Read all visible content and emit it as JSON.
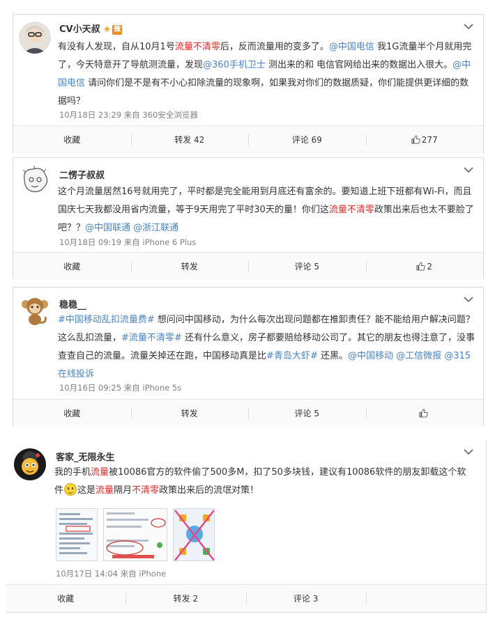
{
  "posts": [
    {
      "user": "CV小天叔",
      "badge_star": "★",
      "badge_vip": "微",
      "text_segments": [
        {
          "t": "有没有人发现，自从10月1号",
          "k": "n"
        },
        {
          "t": "流量不清零",
          "k": "h"
        },
        {
          "t": "后，反而流量用的变多了。",
          "k": "n"
        },
        {
          "t": "@中国电信",
          "k": "l"
        },
        {
          "t": " 我1G流量半个月就用完了，今天特意开了导航测流量，发现",
          "k": "n"
        },
        {
          "t": "@360手机卫士",
          "k": "l"
        },
        {
          "t": " 测出来的和 电信官网给出来的数据出入很大。",
          "k": "n"
        },
        {
          "t": "@中国电信",
          "k": "l"
        },
        {
          "t": " 请问你们是不是有不小心扣除流量的现象啊，如果我对你们的数据质疑，你们能提供更详细的数据吗？",
          "k": "n"
        }
      ],
      "meta": "10月18日 23:29 来自 360安全浏览器",
      "actions": {
        "collect": "收藏",
        "repost": "转发 42",
        "comment": "评论 69",
        "like": "277"
      }
    },
    {
      "user": "二愣子叔叔",
      "text_segments": [
        {
          "t": "这个月流量居然16号就用完了，平时都是完全能用到月底还有富余的。要知道上班下班都有Wi-Fi，而且国庆七天我都没用省内流量，等于9天用完了平时30天的量！你们这",
          "k": "n"
        },
        {
          "t": "流量不清零",
          "k": "h"
        },
        {
          "t": "政策出来后也太不要脸了吧？？",
          "k": "n"
        },
        {
          "t": "@中国联通",
          "k": "l"
        },
        {
          "t": " ",
          "k": "n"
        },
        {
          "t": "@浙江联通",
          "k": "l"
        }
      ],
      "meta": "10月18日 09:19 来自 iPhone 6 Plus",
      "actions": {
        "collect": "收藏",
        "repost": "转发",
        "comment": "评论 5",
        "like": "2"
      }
    },
    {
      "user": "稳稳__",
      "text_segments": [
        {
          "t": "#中国移动乱扣流量费#",
          "k": "l"
        },
        {
          "t": " 想问问中国移动，为什么每次出现问题都在推卸责任？能不能给用户解决问题？这么乱扣流量，",
          "k": "n"
        },
        {
          "t": "#流量不清零#",
          "k": "l"
        },
        {
          "t": " 还有什么意义，房子都要赔给移动公司了。其它的朋友也得注意了，没事查查自己的流量。流量关掉还在跑，中国移动真是比",
          "k": "n"
        },
        {
          "t": "#青岛大虾#",
          "k": "l"
        },
        {
          "t": " 还黑。",
          "k": "n"
        },
        {
          "t": "@中国移动",
          "k": "l"
        },
        {
          "t": " ",
          "k": "n"
        },
        {
          "t": "@工信微报",
          "k": "l"
        },
        {
          "t": " ",
          "k": "n"
        },
        {
          "t": "@315在线投诉",
          "k": "l"
        }
      ],
      "meta": "10月16日 09:25 来自 iPhone 5s",
      "actions": {
        "collect": "收藏",
        "repost": "转发",
        "comment": "评论 5",
        "like": ""
      }
    },
    {
      "user": "客家_无限永生",
      "text_segments": [
        {
          "t": "我的手机",
          "k": "n"
        },
        {
          "t": "流量",
          "k": "h"
        },
        {
          "t": "被10086官方的软件偷了500多M，扣了50多块钱，建议有10086软件的朋友卸载这个软件",
          "k": "n"
        },
        {
          "t": "[smile]",
          "k": "e"
        },
        {
          "t": "这是",
          "k": "n"
        },
        {
          "t": "流量",
          "k": "h"
        },
        {
          "t": "隔月",
          "k": "n"
        },
        {
          "t": "不清零",
          "k": "h"
        },
        {
          "t": "政策出来后的流氓对策！",
          "k": "n"
        }
      ],
      "meta": "10月17日 14:04 来自 iPhone",
      "actions": {
        "collect": "收藏",
        "repost": "转发 2",
        "comment": "评论 3",
        "like": ""
      }
    }
  ],
  "colors": {
    "highlight": "#e02828",
    "link": "#4a84c4",
    "meta": "#808080"
  }
}
